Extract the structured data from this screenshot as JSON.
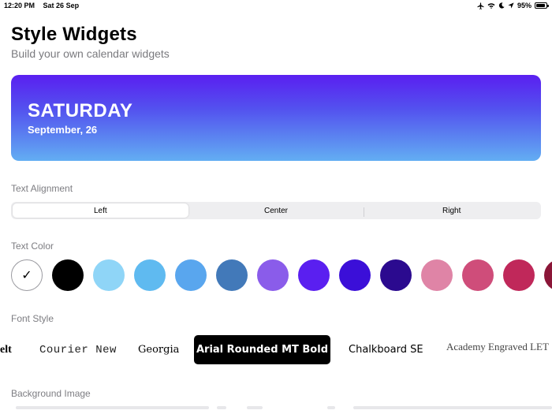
{
  "status_bar": {
    "time": "12:20 PM",
    "date": "Sat 26 Sep",
    "battery": "95%",
    "battery_level": 0.95,
    "icons": [
      "airplane-icon",
      "wifi-icon",
      "moon-icon",
      "location-icon"
    ]
  },
  "header": {
    "title": "Style Widgets",
    "subtitle": "Build your own calendar widgets"
  },
  "preview": {
    "day": "SATURDAY",
    "date": "September, 26",
    "gradient": [
      "#5a1ff0",
      "#63aef3"
    ]
  },
  "alignment": {
    "label": "Text Alignment",
    "options": [
      "Left",
      "Center",
      "Right"
    ],
    "selected": "Left"
  },
  "text_color": {
    "label": "Text Color",
    "selected_mark": "✓",
    "swatches": [
      "#ffffff",
      "#000000",
      "#8fd5f7",
      "#5fbaf0",
      "#59a6ee",
      "#4279b9",
      "#8a5cea",
      "#5a1ff0",
      "#3b0fd8",
      "#2b0a8f",
      "#df84a6",
      "#cf4d7a",
      "#c0285a",
      "#8b1638"
    ]
  },
  "font_style": {
    "label": "Font Style",
    "options": [
      "elt",
      "Courier New",
      "Georgia",
      "Arial Rounded MT Bold",
      "Chalkboard SE",
      "Academy Engraved LET"
    ],
    "selected": "Arial Rounded MT Bold"
  },
  "background": {
    "label": "Background Image"
  }
}
